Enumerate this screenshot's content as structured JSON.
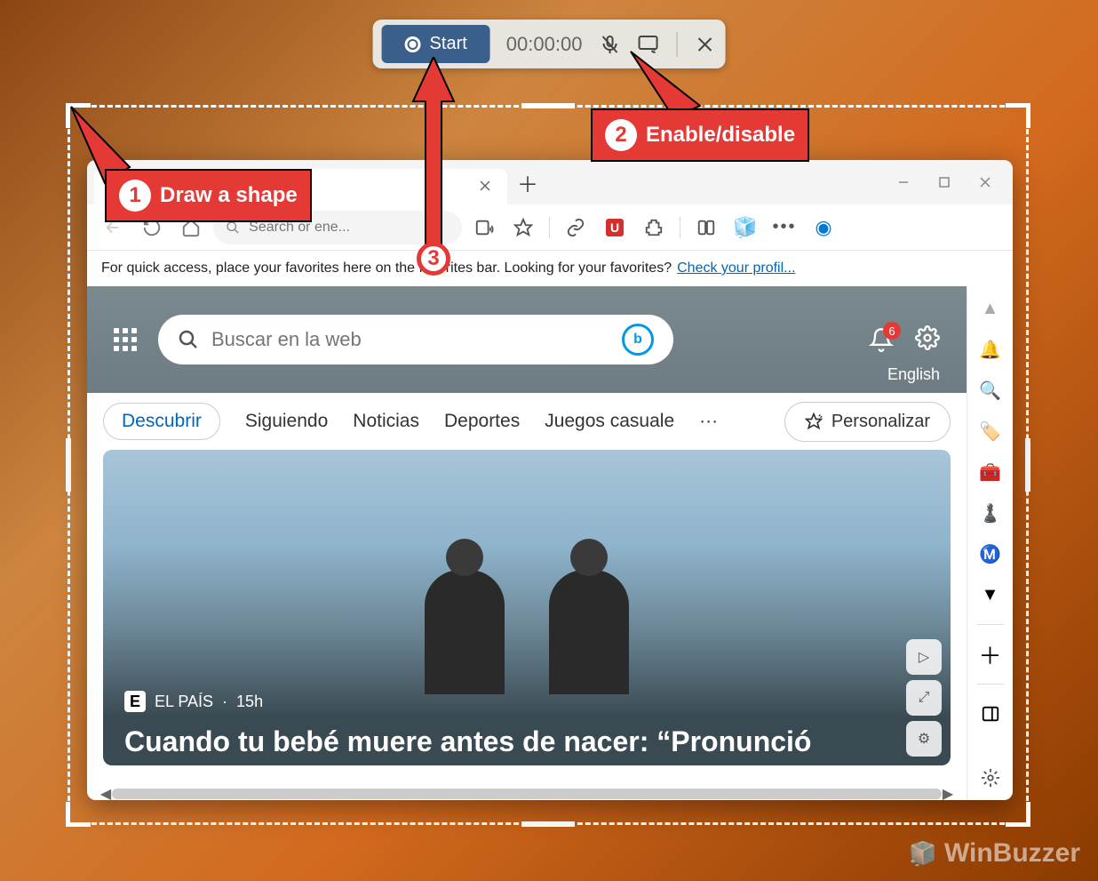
{
  "recording_bar": {
    "start_label": "Start",
    "timer": "00:00:00"
  },
  "annotations": {
    "step1": "Draw a shape",
    "step2": "Enable/disable",
    "num1": "1",
    "num2": "2",
    "num3": "3"
  },
  "browser": {
    "address_placeholder": "Search or en​e...",
    "favorites_bar_text": "For quick access, place your favorites here on the favorites bar. Looking for your favorites?",
    "favorites_bar_link": "Check your profil...",
    "newtab": {
      "search_placeholder": "Buscar en la web",
      "notifications_count": "6",
      "language": "English",
      "tabs": [
        "Descubrir",
        "Siguiendo",
        "Noticias",
        "Deportes",
        "Juegos casuale"
      ],
      "more": "···",
      "personalize": "Personalizar",
      "card": {
        "source_badge": "E",
        "source": "EL PAÍS",
        "time": "15h",
        "headline": "Cuando tu bebé muere antes de nacer: “Pronunció"
      }
    }
  },
  "watermark": "WinBuzzer"
}
